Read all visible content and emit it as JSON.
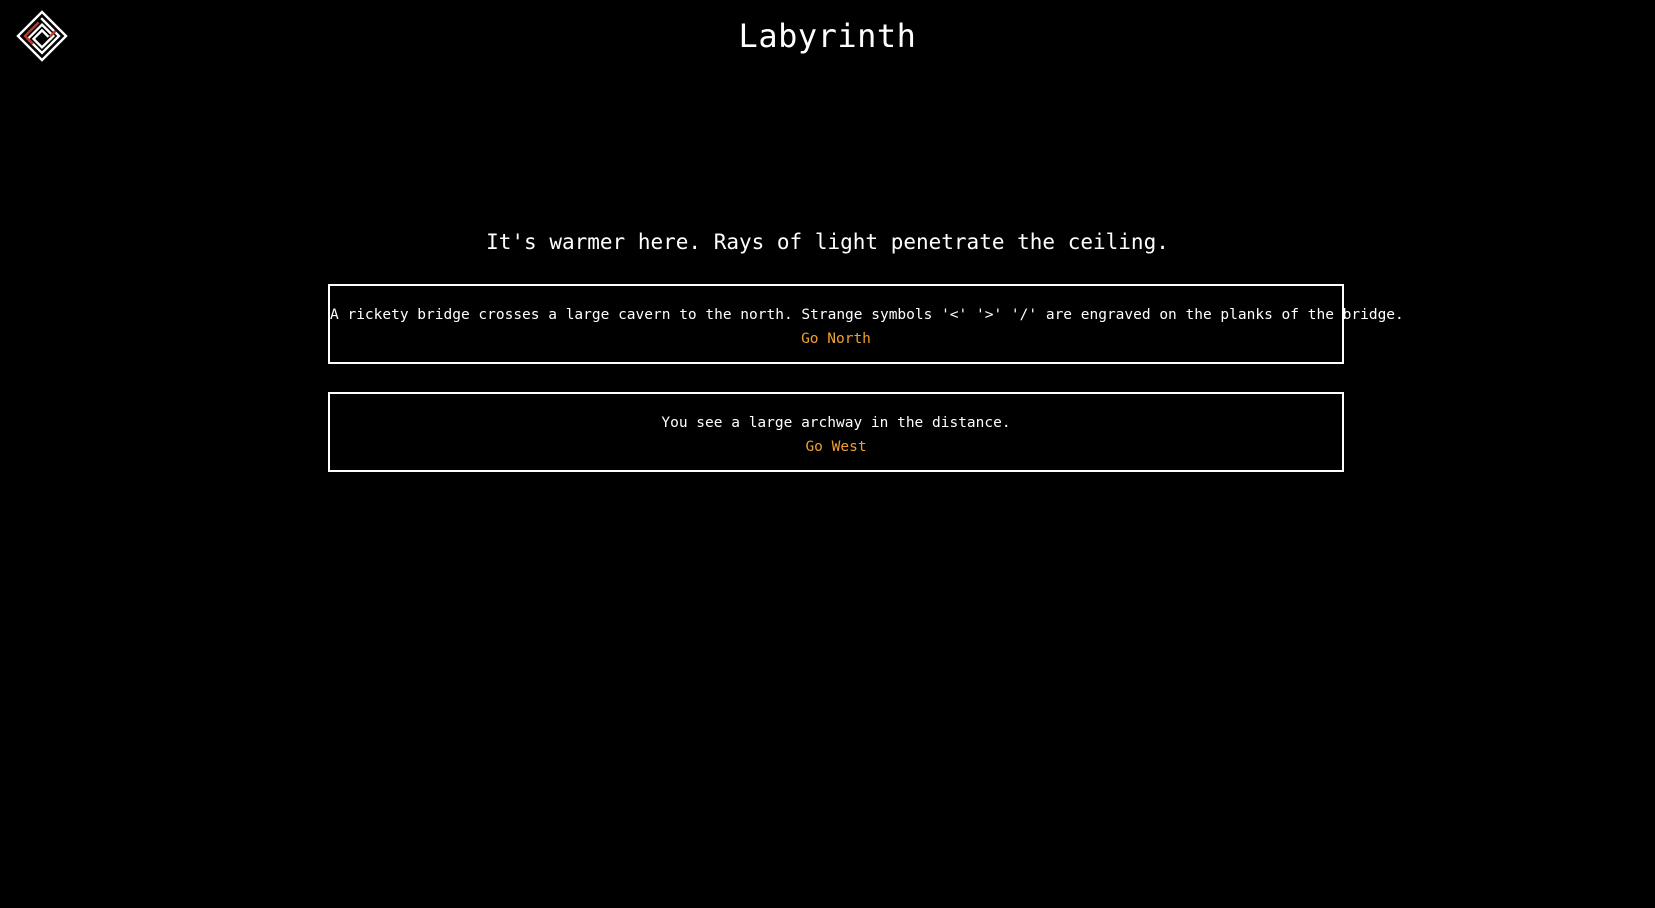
{
  "header": {
    "logo_icon": "labyrinth-maze-icon",
    "title": "Labyrinth"
  },
  "scene": {
    "description": "It's warmer here. Rays of light penetrate the ceiling."
  },
  "choices": [
    {
      "text": "A rickety bridge crosses a large cavern to the north. Strange symbols '<' '>' '/' are engraved on the planks of the bridge.",
      "action": "Go North"
    },
    {
      "text": "You see a large archway in the distance.",
      "action": "Go West"
    }
  ],
  "colors": {
    "background": "#000000",
    "text": "#ffffff",
    "action_link": "#f0a030",
    "logo_accent": "#c0392b"
  }
}
